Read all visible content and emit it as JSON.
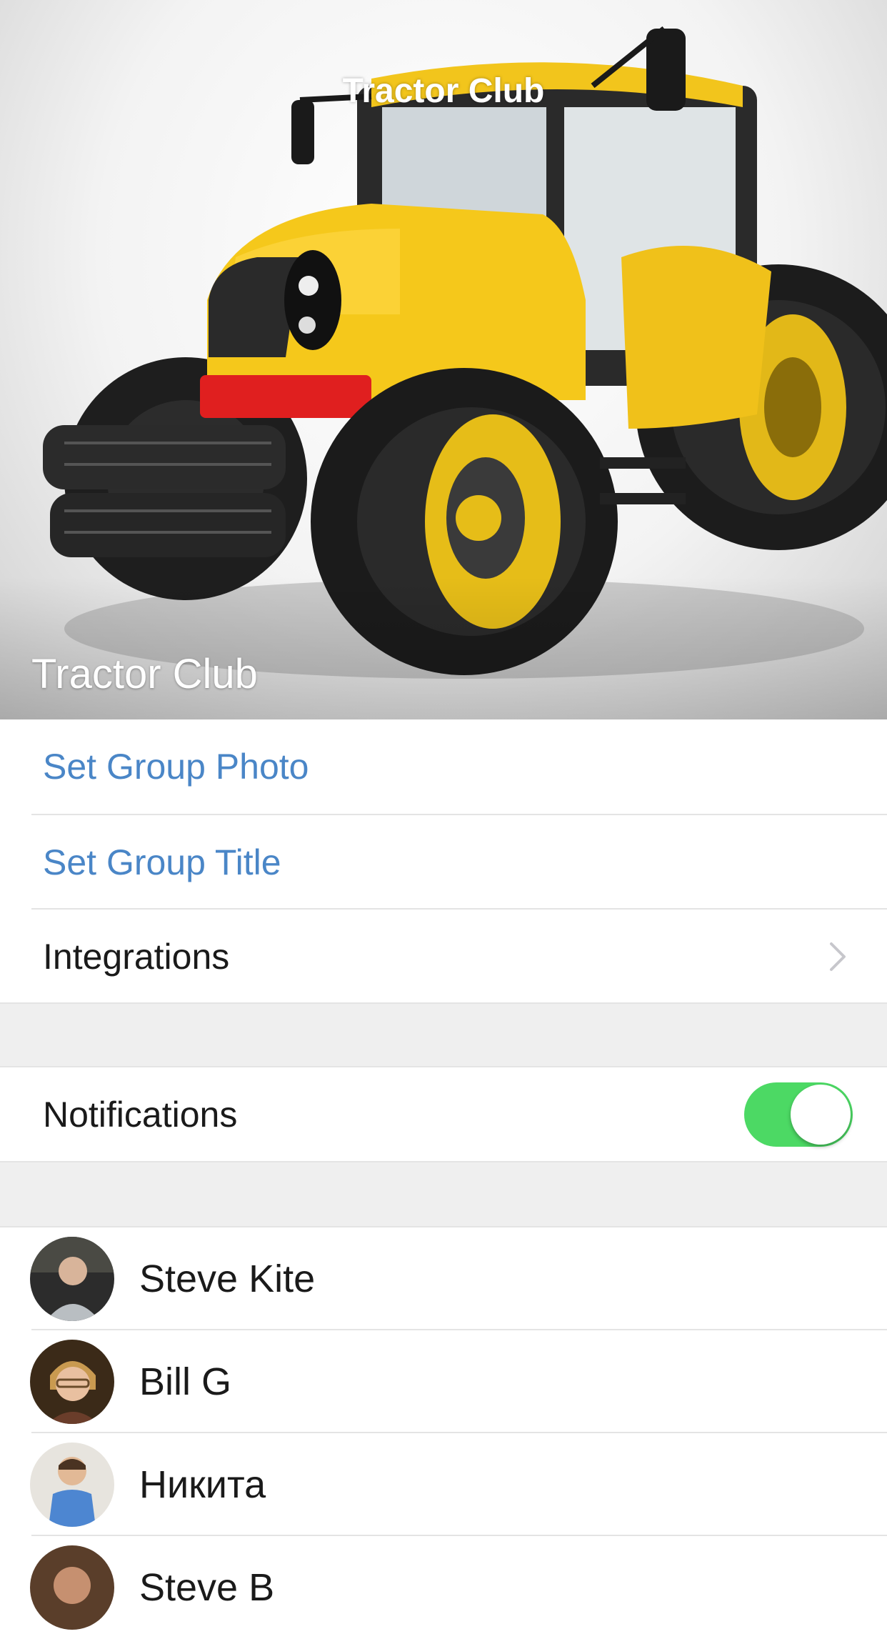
{
  "header": {
    "nav_title": "Tractor Club",
    "group_title": "Tractor Club",
    "photo_subject": "yellow-tractor"
  },
  "actions": {
    "set_photo": "Set Group Photo",
    "set_title": "Set Group Title",
    "integrations": "Integrations"
  },
  "settings": {
    "notifications_label": "Notifications",
    "notifications_enabled": true
  },
  "members": [
    {
      "name": "Steve Kite"
    },
    {
      "name": "Bill G"
    },
    {
      "name": "Никита"
    },
    {
      "name": "Steve B"
    }
  ],
  "colors": {
    "link": "#4a86c7",
    "toggle_on": "#4cd964",
    "section_gap": "#efefef"
  }
}
